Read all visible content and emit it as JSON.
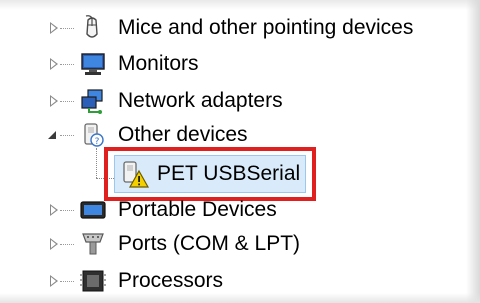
{
  "device_tree": {
    "items": [
      {
        "label": "Mice and other pointing devices",
        "icon": "mouse-icon",
        "expanded": false
      },
      {
        "label": "Monitors",
        "icon": "monitor-icon",
        "expanded": false
      },
      {
        "label": "Network adapters",
        "icon": "network-adapter-icon",
        "expanded": false
      },
      {
        "label": "Other devices",
        "icon": "unknown-device-icon",
        "expanded": true
      },
      {
        "label": "Portable Devices",
        "icon": "portable-device-icon",
        "expanded": false
      },
      {
        "label": "Ports (COM & LPT)",
        "icon": "port-icon",
        "expanded": false
      },
      {
        "label": "Processors",
        "icon": "processor-icon",
        "expanded": false
      }
    ],
    "child": {
      "label": "PET USBSerial",
      "icon": "warning-device-icon",
      "selected": true,
      "highlighted": true
    }
  },
  "colors": {
    "highlight_border": "#e0201f",
    "selection_background": "#d9ebfb",
    "selection_border": "#9cc8f0"
  }
}
